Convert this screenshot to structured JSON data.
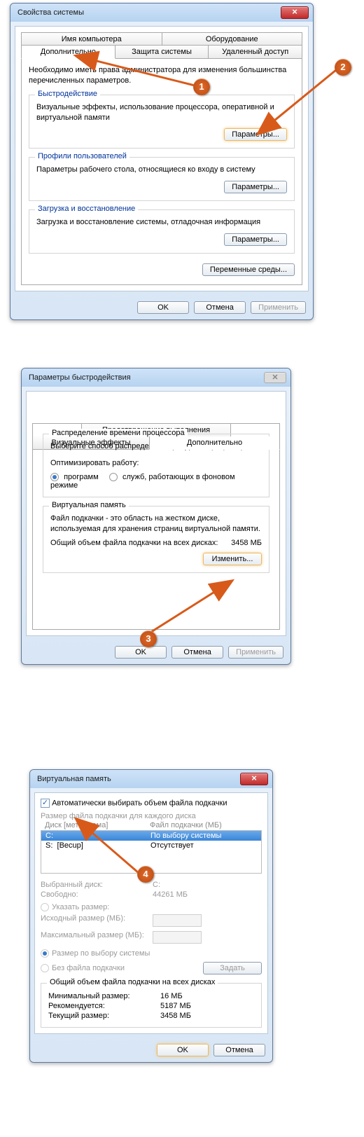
{
  "annotations": {
    "m1": "1",
    "m2": "2",
    "m3": "3",
    "m4": "4"
  },
  "win1": {
    "title": "Свойства системы",
    "tabs_top": {
      "t1": "Имя компьютера",
      "t2": "Оборудование"
    },
    "tabs_bot": {
      "t1": "Дополнительно",
      "t2": "Защита системы",
      "t3": "Удаленный доступ"
    },
    "note": "Необходимо иметь права администратора для изменения большинства перечисленных параметров.",
    "grp1": {
      "title": "Быстродействие",
      "desc": "Визуальные эффекты, использование процессора, оперативной и виртуальной памяти",
      "btn": "Параметры..."
    },
    "grp2": {
      "title": "Профили пользователей",
      "desc": "Параметры рабочего стола, относящиеся ко входу в систему",
      "btn": "Параметры..."
    },
    "grp3": {
      "title": "Загрузка и восстановление",
      "desc": "Загрузка и восстановление системы, отладочная информация",
      "btn": "Параметры..."
    },
    "env_btn": "Переменные среды...",
    "ok": "OK",
    "cancel": "Отмена",
    "apply": "Применить"
  },
  "win2": {
    "title": "Параметры быстродействия",
    "tabs": {
      "t1": "Визуальные эффекты",
      "t2": "Дополнительно",
      "t3": "Предотвращение выполнения данных"
    },
    "cpu": {
      "title": "Распределение времени процессора",
      "desc": "Выберите способ распределения ресурсов процессора.",
      "opt_label": "Оптимизировать работу:",
      "opt1": "программ",
      "opt2": "служб, работающих в фоновом режиме"
    },
    "vmem": {
      "title": "Виртуальная память",
      "desc": "Файл подкачки - это область на жестком диске, используемая для хранения страниц виртуальной памяти.",
      "total_lbl": "Общий объем файла подкачки на всех дисках:",
      "total_val": "3458 МБ",
      "btn": "Изменить..."
    },
    "ok": "OK",
    "cancel": "Отмена",
    "apply": "Применить"
  },
  "win3": {
    "title": "Виртуальная память",
    "auto_cb": "Автоматически выбирать объем файла подкачки",
    "size_each": "Размер файла подкачки для каждого диска",
    "col1": "Диск [метка тома]",
    "col2": "Файл подкачки (МБ)",
    "rows": [
      {
        "drive": "C:",
        "label": "",
        "value": "По выбору системы"
      },
      {
        "drive": "S:",
        "label": "[Becup]",
        "value": "Отсутствует"
      }
    ],
    "sel_drive_lbl": "Выбранный диск:",
    "sel_drive_val": "C:",
    "free_lbl": "Свободно:",
    "free_val": "44261 МБ",
    "opt_custom": "Указать размер:",
    "initial_lbl": "Исходный размер (МБ):",
    "max_lbl": "Максимальный размер (МБ):",
    "opt_sys": "Размер по выбору системы",
    "opt_none": "Без файла подкачки",
    "set_btn": "Задать",
    "totals": {
      "title": "Общий объем файла подкачки на всех дисках",
      "min_k": "Минимальный размер:",
      "min_v": "16 МБ",
      "rec_k": "Рекомендуется:",
      "rec_v": "5187 МБ",
      "cur_k": "Текущий размер:",
      "cur_v": "3458 МБ"
    },
    "ok": "OK",
    "cancel": "Отмена"
  }
}
